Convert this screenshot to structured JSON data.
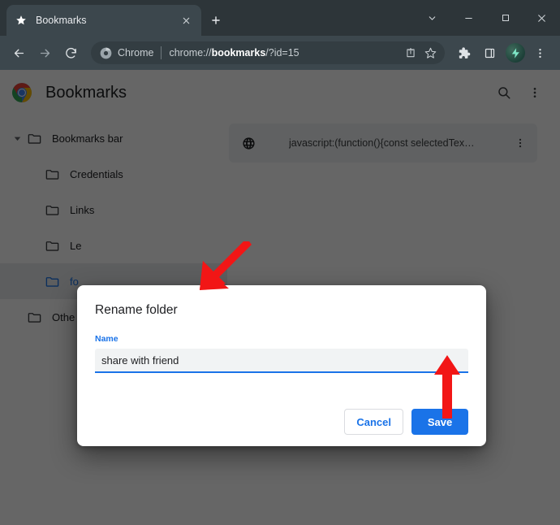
{
  "window": {
    "controls": [
      {
        "name": "tab-search-chevron",
        "glyph": "chevron-down-icon"
      },
      {
        "name": "minimize",
        "glyph": "minimize-icon"
      },
      {
        "name": "maximize",
        "glyph": "maximize-icon"
      },
      {
        "name": "close",
        "glyph": "close-icon"
      }
    ]
  },
  "tabstrip": {
    "tab": {
      "title": "Bookmarks",
      "favicon": "star-icon",
      "close_label": "×"
    },
    "new_tab_label": "+"
  },
  "toolbar": {
    "back_icon": "back-arrow-icon",
    "forward_icon": "forward-arrow-icon",
    "reload_icon": "reload-icon",
    "omnibox": {
      "chip_label": "Chrome",
      "chip_icon": "chrome-icon",
      "url_prefix": "chrome://",
      "url_bold": "bookmarks",
      "url_suffix": "/?id=15",
      "url_full": "chrome://bookmarks/?id=15",
      "share_icon": "share-icon",
      "bookmark_icon": "star-outline-icon"
    },
    "extensions_icon": "puzzle-icon",
    "side_panel_icon": "side-panel-icon",
    "profile_avatar": "avatar",
    "menu_icon": "three-dot-menu-icon"
  },
  "bookmarks_page": {
    "logo": "chrome-logo",
    "title": "Bookmarks",
    "search_icon": "search-icon",
    "menu_icon": "three-dot-menu-icon",
    "tree": [
      {
        "label": "Bookmarks bar",
        "expanded": true,
        "depth": 0,
        "selected": false,
        "has_arrow": true
      },
      {
        "label": "Credentials",
        "expanded": false,
        "depth": 1,
        "selected": false,
        "has_arrow": false
      },
      {
        "label": "Links",
        "expanded": false,
        "depth": 1,
        "selected": false,
        "has_arrow": false
      },
      {
        "label": "Le",
        "expanded": false,
        "depth": 1,
        "selected": false,
        "has_arrow": false
      },
      {
        "label": "fo",
        "expanded": false,
        "depth": 1,
        "selected": true,
        "has_arrow": false
      },
      {
        "label": "Othe",
        "expanded": false,
        "depth": 0,
        "selected": false,
        "has_arrow": false
      }
    ],
    "items": [
      {
        "icon": "globe-icon",
        "text": "javascript:(function(){const selectedTex…",
        "menu_icon": "three-dot-menu-icon"
      }
    ]
  },
  "dialog": {
    "title": "Rename folder",
    "field_label": "Name",
    "input_value": "share with friend",
    "input_placeholder": "Name",
    "cancel_label": "Cancel",
    "save_label": "Save"
  },
  "annotations": {
    "arrow_to_input": "red-arrow-pointing-to-name-input",
    "arrow_to_save": "red-arrow-pointing-to-save-button"
  },
  "colors": {
    "accent_blue": "#1a73e8",
    "tabstrip_bg": "#2d3539",
    "toolbar_bg": "#3c474d",
    "omnibox_bg": "#333d42",
    "annotation_red": "#f21616",
    "selected_row_bg": "#e8eaed"
  }
}
